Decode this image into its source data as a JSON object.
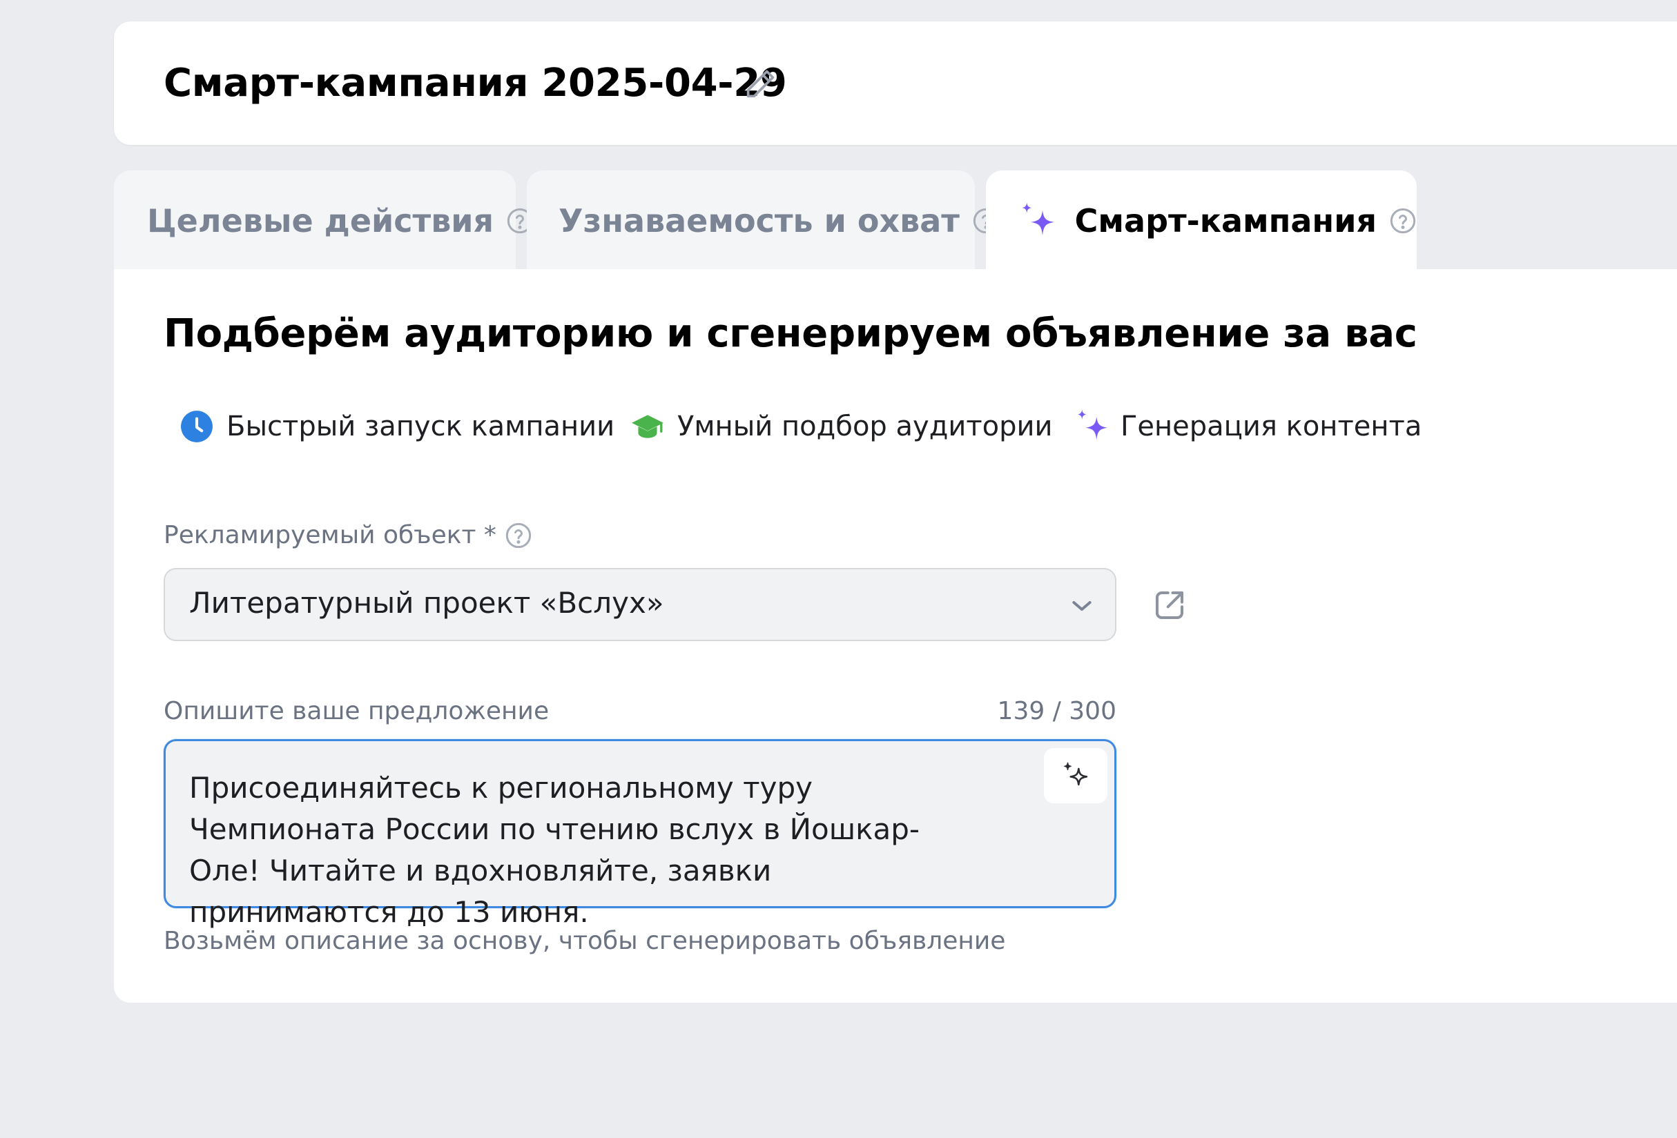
{
  "header": {
    "title": "Смарт-кампания 2025-04-29"
  },
  "tabs": [
    {
      "label": "Целевые действия",
      "active": false
    },
    {
      "label": "Узнаваемость и охват",
      "active": false
    },
    {
      "label": "Смарт-кампания",
      "active": true
    }
  ],
  "main": {
    "title": "Подберём аудиторию и сгенерируем объявление за вас",
    "features": [
      {
        "icon": "clock-icon",
        "label": "Быстрый запуск кампании"
      },
      {
        "icon": "graduation-cap-icon",
        "label": "Умный подбор аудитории"
      },
      {
        "icon": "sparkles-icon",
        "label": "Генерация контента"
      }
    ],
    "object_field": {
      "label": "Рекламируемый объект *",
      "value": "Литературный проект «Вслух»"
    },
    "description_field": {
      "label": "Опишите ваше предложение",
      "counter": "139 / 300",
      "value": "Присоединяйтесь к региональному туру Чемпионата России по чтению вслух в Йошкар-Оле! Читайте и вдохновляйте, заявки принимаются до 13 июня.",
      "hint": "Возьмём описание за основу, чтобы сгенерировать объявление"
    }
  },
  "colors": {
    "accent_blue": "#3f8ae0",
    "sparkle_purple": "#7a5af5",
    "clock_blue": "#2d81e0",
    "cap_green": "#4bb34b",
    "muted_text": "#6b7382"
  }
}
